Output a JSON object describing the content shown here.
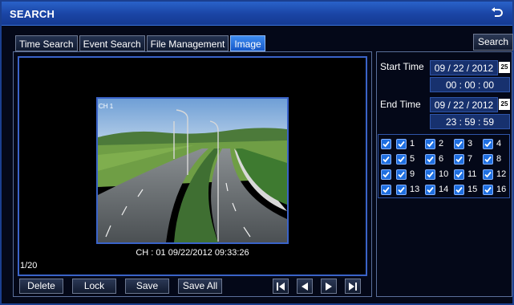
{
  "window": {
    "title": "SEARCH"
  },
  "tabs": [
    {
      "label": "Time Search",
      "active": false
    },
    {
      "label": "Event Search",
      "active": false
    },
    {
      "label": "File Management",
      "active": false
    },
    {
      "label": "Image",
      "active": true
    }
  ],
  "search_button": "Search",
  "viewer": {
    "channel_overlay": "CH 1",
    "caption": "CH : 01   09/22/2012 09:33:26",
    "counter": "1/20"
  },
  "actions": {
    "delete": "Delete",
    "lock": "Lock",
    "save": "Save",
    "save_all": "Save All"
  },
  "navigation": [
    "first-icon",
    "previous-icon",
    "next-icon",
    "last-icon"
  ],
  "time_filter": {
    "start_label": "Start Time",
    "start_date": "09 / 22 / 2012",
    "start_time": "00  :  00  :  00",
    "end_label": "End Time",
    "end_date": "09 / 22 / 2012",
    "end_time": "23  :  59  :  59",
    "calendar_icon_text": "25"
  },
  "channels": {
    "rows": [
      [
        "1",
        "2",
        "3",
        "4"
      ],
      [
        "5",
        "6",
        "7",
        "8"
      ],
      [
        "9",
        "10",
        "11",
        "12"
      ],
      [
        "13",
        "14",
        "15",
        "16"
      ]
    ]
  },
  "colors": {
    "title_bar": "#1a44a4",
    "active_tab": "#1e6ae0",
    "checkbox": "#1f6fe0",
    "panel_border": "#5a6f9a"
  }
}
